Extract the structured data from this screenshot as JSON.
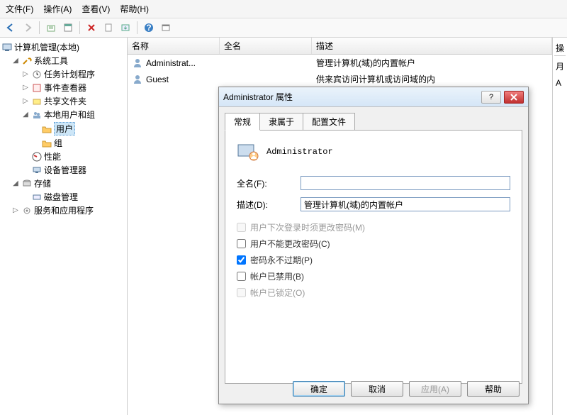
{
  "menu": {
    "file": "文件(F)",
    "action": "操作(A)",
    "view": "查看(V)",
    "help": "帮助(H)"
  },
  "tree": {
    "root": "计算机管理(本地)",
    "system_tools": "系统工具",
    "task_scheduler": "任务计划程序",
    "event_viewer": "事件查看器",
    "shared_folders": "共享文件夹",
    "local_users_groups": "本地用户和组",
    "users": "用户",
    "groups": "组",
    "performance": "性能",
    "device_manager": "设备管理器",
    "storage": "存储",
    "disk_mgmt": "磁盘管理",
    "services_apps": "服务和应用程序"
  },
  "list": {
    "col_name": "名称",
    "col_full": "全名",
    "col_desc": "描述",
    "rows": [
      {
        "name": "Administrat...",
        "full": "",
        "desc": "管理计算机(域)的内置帐户"
      },
      {
        "name": "Guest",
        "full": "",
        "desc": "供来宾访问计算机或访问域的内"
      }
    ]
  },
  "rightcol": {
    "header": "操",
    "line1": "月",
    "line2": "A"
  },
  "dialog": {
    "title": "Administrator 属性",
    "tabs": {
      "general": "常规",
      "memberof": "隶属于",
      "profile": "配置文件"
    },
    "username": "Administrator",
    "fullname_label": "全名(F):",
    "fullname_value": "",
    "desc_label": "描述(D):",
    "desc_value": "管理计算机(域)的内置帐户",
    "chk_must_change": "用户下次登录时须更改密码(M)",
    "chk_cannot_change": "用户不能更改密码(C)",
    "chk_never_expire": "密码永不过期(P)",
    "chk_disabled": "帐户已禁用(B)",
    "chk_locked": "帐户已锁定(O)",
    "btn_ok": "确定",
    "btn_cancel": "取消",
    "btn_apply": "应用(A)",
    "btn_help": "帮助"
  }
}
